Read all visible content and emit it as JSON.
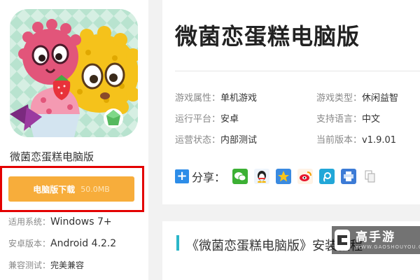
{
  "app": {
    "name": "微菌恋蛋糕电脑版",
    "download_label": "电脑版下载",
    "download_size": "50.0MB"
  },
  "meta": [
    {
      "key": "适用系统：",
      "value": "Windows 7+"
    },
    {
      "key": "安卓版本：",
      "value": "Android 4.2.2"
    },
    {
      "key": "兼容测试：",
      "value": "完美兼容"
    }
  ],
  "main": {
    "title": "微菌恋蛋糕电脑版",
    "attributes": [
      {
        "key": "游戏属性：",
        "value": "单机游戏"
      },
      {
        "key": "游戏类型：",
        "value": "休闲益智"
      },
      {
        "key": "运行平台：",
        "value": "安卓"
      },
      {
        "key": "支持语言：",
        "value": "中文"
      },
      {
        "key": "运营状态：",
        "value": "内部测试"
      },
      {
        "key": "当前版本：",
        "value": "v1.9.01"
      }
    ],
    "share_label": "分享：",
    "share_icons": [
      "wechat-icon",
      "qq-icon",
      "qzone-icon",
      "weibo-icon",
      "tencent-weibo-icon",
      "print-icon",
      "copy-icon"
    ]
  },
  "section": {
    "title": "《微菌恋蛋糕电脑版》安装教程"
  },
  "watermark": {
    "brand": "高手游",
    "url": "WWW.GAOSHOUYOU.COM"
  },
  "colors": {
    "download_button": "#f7ad3b",
    "highlight_border": "#e30000",
    "accent_bar": "#2bb6c9",
    "share_plus": "#2d8de8"
  }
}
